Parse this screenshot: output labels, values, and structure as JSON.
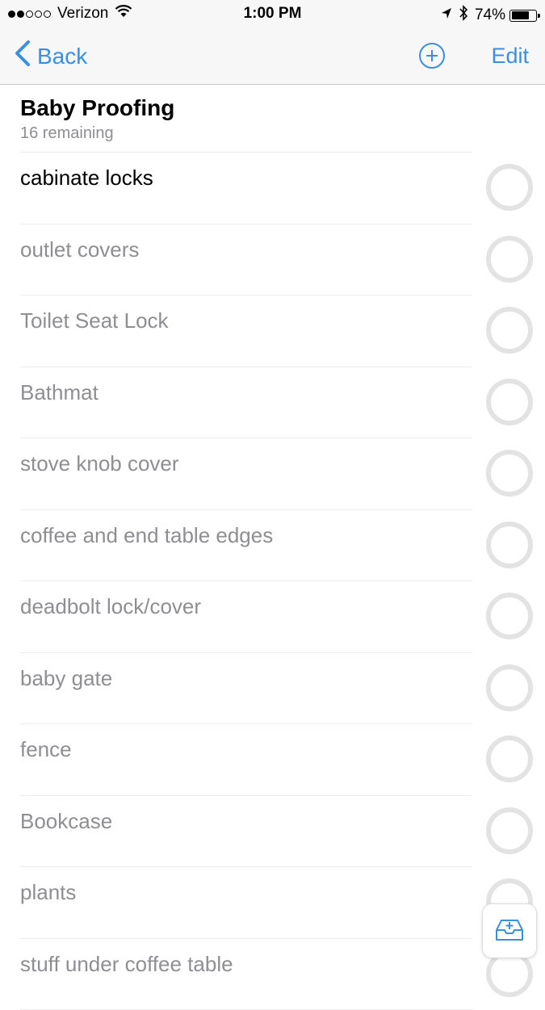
{
  "status_bar": {
    "carrier": "Verizon",
    "time": "1:00 PM",
    "battery": "74%",
    "battery_level": 0.74,
    "signal_bars_filled": 2,
    "signal_bars_total": 5
  },
  "nav": {
    "back_label": "Back",
    "edit_label": "Edit",
    "accent_color": "#3b8fe0"
  },
  "list": {
    "title": "Baby Proofing",
    "remaining": "16 remaining",
    "items": [
      {
        "label": "cabinate locks"
      },
      {
        "label": "outlet covers"
      },
      {
        "label": "Toilet Seat Lock"
      },
      {
        "label": "Bathmat"
      },
      {
        "label": "stove knob cover"
      },
      {
        "label": "coffee and end table edges"
      },
      {
        "label": "deadbolt lock/cover"
      },
      {
        "label": "baby gate"
      },
      {
        "label": "fence"
      },
      {
        "label": "Bookcase"
      },
      {
        "label": "plants"
      },
      {
        "label": "stuff under coffee table"
      }
    ]
  },
  "icons": {
    "location": "location-arrow-icon",
    "bluetooth": "bluetooth-icon",
    "wifi": "wifi-icon",
    "add": "plus-circle-icon",
    "inbox": "inbox-add-icon"
  }
}
